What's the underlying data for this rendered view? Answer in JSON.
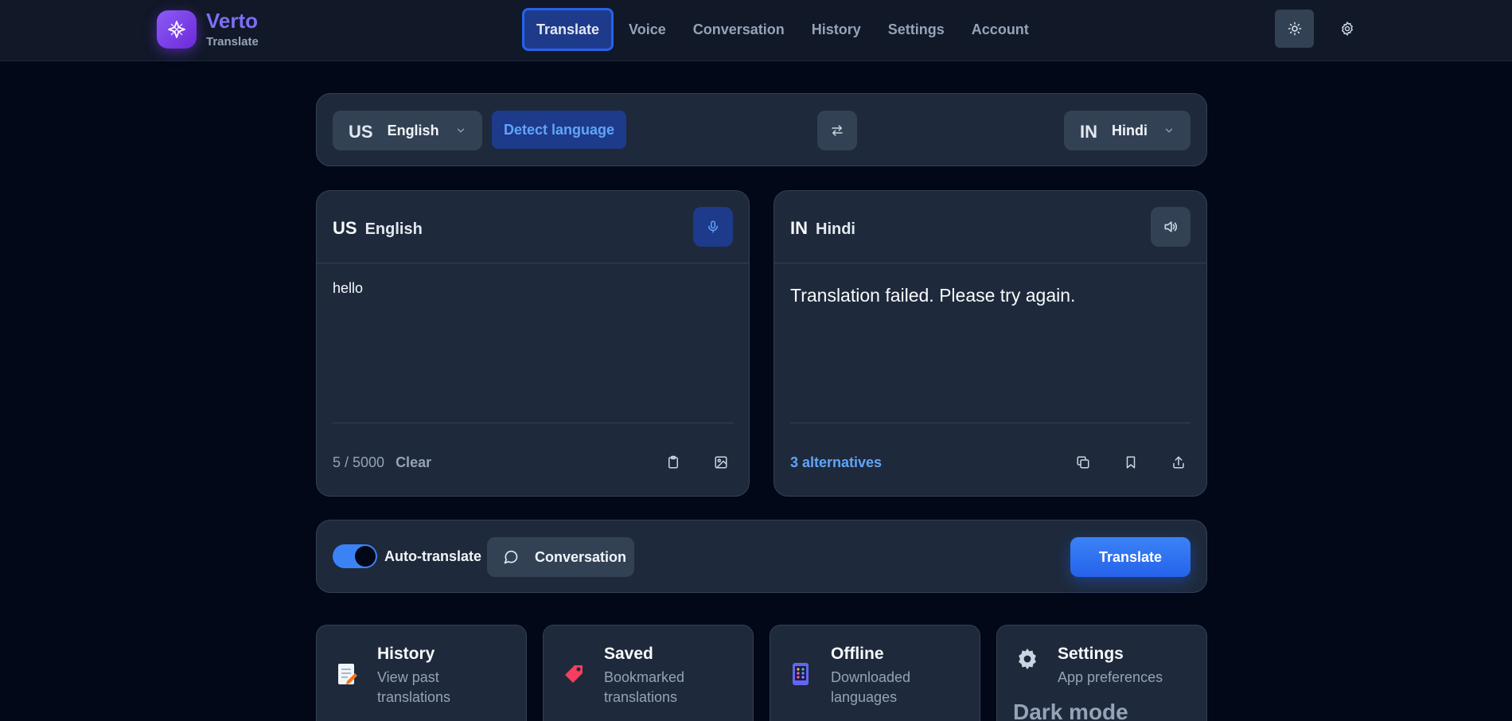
{
  "brand": {
    "name": "Verto",
    "subtitle": "Translate"
  },
  "nav": {
    "items": [
      {
        "label": "Translate",
        "active": true
      },
      {
        "label": "Voice"
      },
      {
        "label": "Conversation"
      },
      {
        "label": "History"
      },
      {
        "label": "Settings"
      },
      {
        "label": "Account"
      }
    ]
  },
  "icons": {
    "logo": "sparkle-star-icon",
    "theme": "sun-icon",
    "settings": "gear-icon",
    "swap": "swap-arrows-icon",
    "mic": "microphone-icon",
    "speaker": "speaker-icon",
    "paste": "clipboard-icon",
    "image": "image-icon",
    "copy": "copy-icon",
    "bookmark": "bookmark-icon",
    "share": "share-icon",
    "chat": "chat-bubble-icon"
  },
  "language_bar": {
    "source": {
      "code": "US",
      "name": "English"
    },
    "detect_label": "Detect language",
    "target": {
      "code": "IN",
      "name": "Hindi"
    }
  },
  "source_panel": {
    "code": "US",
    "name": "English",
    "text": "hello",
    "counter": "5 / 5000",
    "clear_label": "Clear"
  },
  "target_panel": {
    "code": "IN",
    "name": "Hindi",
    "text": "Translation failed. Please try again.",
    "alternatives_label": "3 alternatives"
  },
  "actions": {
    "auto_translate_label": "Auto-translate",
    "auto_translate_on": true,
    "conversation_label": "Conversation",
    "translate_label": "Translate"
  },
  "cards": [
    {
      "title": "History",
      "desc": "View past translations",
      "icon": "memo-icon"
    },
    {
      "title": "Saved",
      "desc": "Bookmarked translations",
      "icon": "bookmark-tag-icon"
    },
    {
      "title": "Offline",
      "desc": "Downloaded languages",
      "icon": "phone-icon"
    },
    {
      "title": "Settings",
      "desc": "App preferences",
      "icon": "gear-icon",
      "extra": "Dark mode"
    }
  ],
  "colors": {
    "background": "#020817",
    "panel": "#1e293b",
    "accent": "#3b82f6",
    "brand": "#7c6ff5",
    "link": "#60a5fa"
  }
}
